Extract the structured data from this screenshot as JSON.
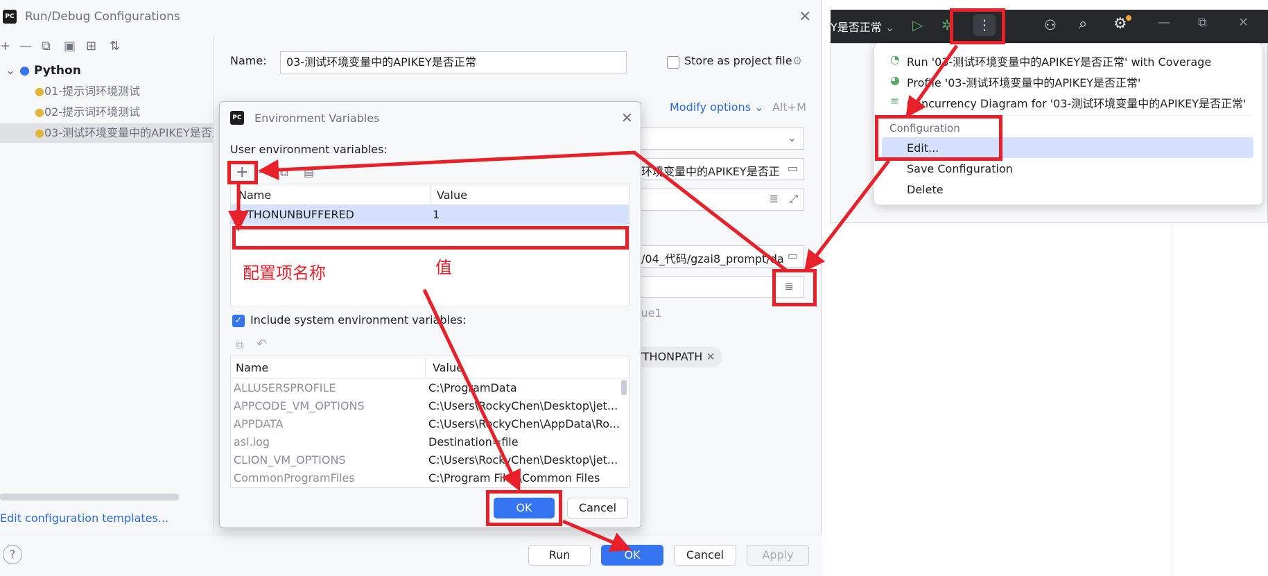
{
  "main_dialog": {
    "title": "Run/Debug Configurations",
    "logo_text": "PC",
    "tree_root": "Python",
    "tree_items": [
      "01-提示词环境测试",
      "02-提示词环境测试",
      "03-测试环境变量中的APIKEY是否正常"
    ],
    "name_label": "Name:",
    "name_value": "03-测试环境变量中的APIKEY是否正常",
    "store_label": "Store as project file",
    "modify_options": "Modify options",
    "modify_shortcut": "Alt+M",
    "script_path_fragment": "环境变量中的APIKEY是否正",
    "workdir_fragment": "/04_代码/gzai8_prompt/da",
    "value_hint": "lue1",
    "pythonpath_chip": "YTHONPATH",
    "edit_templates": "Edit configuration templates...",
    "help": "?",
    "buttons": {
      "run": "Run",
      "ok": "OK",
      "cancel": "Cancel",
      "apply": "Apply"
    }
  },
  "ide": {
    "run_config_label": "Y是否正常",
    "popup": {
      "items": [
        "Run '03-测试环境变量中的APIKEY是否正常' with Coverage",
        "Profile '03-测试环境变量中的APIKEY是否正常'",
        "Concurrency Diagram for '03-测试环境变量中的APIKEY是否正常'"
      ],
      "section": "Configuration",
      "edit": "Edit...",
      "save": "Save Configuration",
      "delete": "Delete"
    }
  },
  "env_dialog": {
    "title": "Environment Variables",
    "user_label": "User environment variables:",
    "columns": [
      "Name",
      "Value"
    ],
    "user_rows": [
      {
        "name": "PYTHONUNBUFFERED",
        "value": "1"
      }
    ],
    "include_system": "Include system environment variables:",
    "system_rows": [
      {
        "name": "ALLUSERSPROFILE",
        "value": "C:\\ProgramData"
      },
      {
        "name": "APPCODE_VM_OPTIONS",
        "value": "C:\\Users\\RockyChen\\Desktop\\jet..."
      },
      {
        "name": "APPDATA",
        "value": "C:\\Users\\RockyChen\\AppData\\Ro..."
      },
      {
        "name": "asl.log",
        "value": "Destination=file"
      },
      {
        "name": "CLION_VM_OPTIONS",
        "value": "C:\\Users\\RockyChen\\Desktop\\jet..."
      },
      {
        "name": "CommonProgramFiles",
        "value": "C:\\Program Files\\Common Files"
      }
    ],
    "ok": "OK",
    "cancel": "Cancel"
  },
  "annotations": {
    "name_label": "配置项名称",
    "value_label": "值"
  },
  "colors": {
    "accent": "#3574f0",
    "annotation": "#e8202a",
    "selection": "#d5e1ff"
  }
}
